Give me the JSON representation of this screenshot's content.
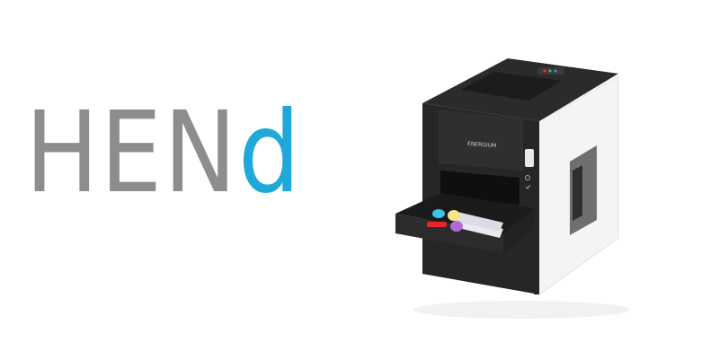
{
  "logo": {
    "primary_text": "HEN",
    "accent_text": "d",
    "primary_color": "#8c8d8f",
    "accent_color": "#1fa8d8"
  },
  "device": {
    "brand_label": "ENERGIUM",
    "tube_cap_colors": [
      "#f3e48a",
      "#3cc3e6",
      "#b56ad8",
      "#e8262a"
    ]
  }
}
